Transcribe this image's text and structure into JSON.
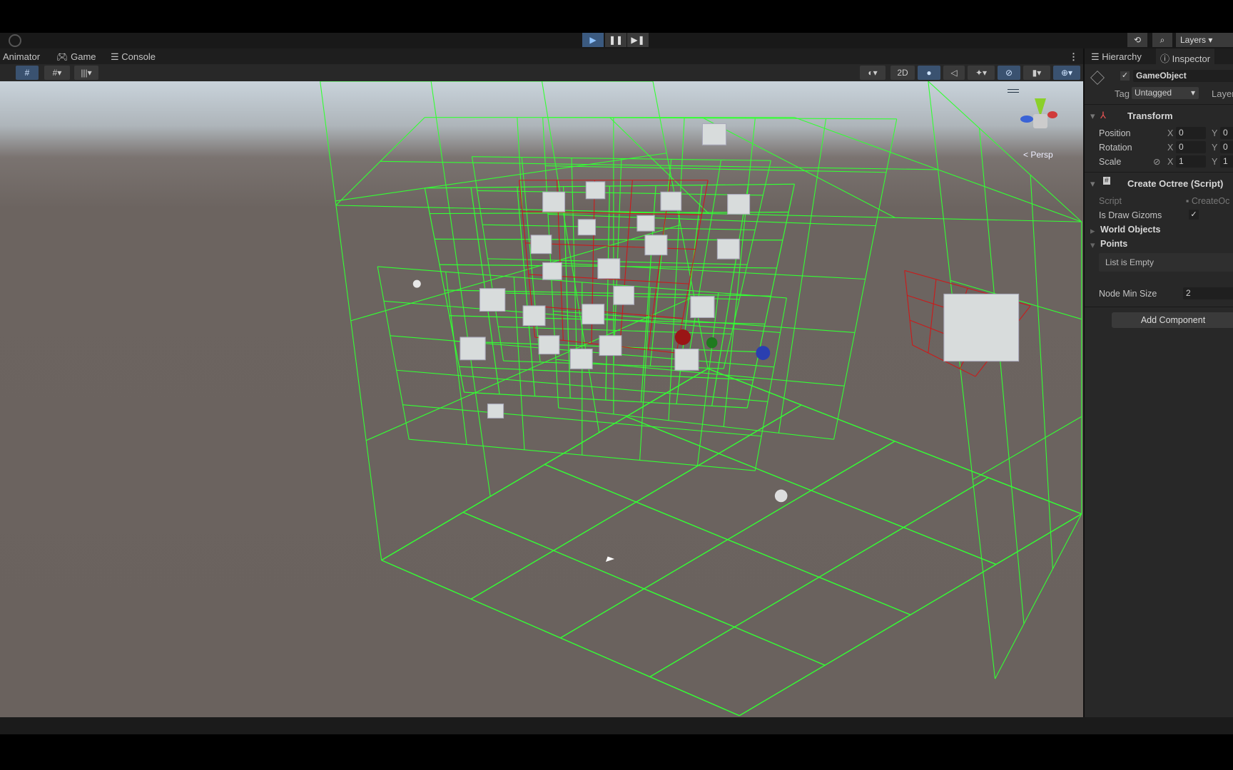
{
  "toolbar": {
    "play_icon": "play-icon",
    "pause_icon": "pause-icon",
    "step_icon": "step-icon",
    "play": "▶",
    "pause": "❚❚",
    "step": "▶❚",
    "history_icon": "history-icon",
    "search_icon": "search-icon",
    "layers": "Layers"
  },
  "tabs": {
    "animator": "Animator",
    "game": "Game",
    "console": "Console"
  },
  "scene_toolbar": {
    "mode_2d": "2D",
    "persp": "< Persp"
  },
  "inspector": {
    "tabs": {
      "hierarchy": "Hierarchy",
      "inspector": "Inspector"
    },
    "object_name": "GameObject",
    "active": true,
    "tag_label": "Tag",
    "tag_value": "Untagged",
    "layer_label": "Layer",
    "transform": {
      "title": "Transform",
      "position": {
        "label": "Position",
        "x": "0",
        "y": "0"
      },
      "rotation": {
        "label": "Rotation",
        "x": "0",
        "y": "0"
      },
      "scale": {
        "label": "Scale",
        "x": "1",
        "y": "1"
      },
      "x_label": "X",
      "y_label": "Y"
    },
    "script_component": {
      "title": "Create Octree (Script)",
      "script_label": "Script",
      "script_value": "CreateOc",
      "draw_gizmos_label": "Is Draw Gizoms",
      "draw_gizmos": true,
      "world_objects": "World Objects",
      "points": "Points",
      "points_empty": "List is Empty",
      "node_min_size_label": "Node Min Size",
      "node_min_size": "2"
    },
    "add_component": "Add Component"
  },
  "colors": {
    "octree_green": "#33ff33",
    "octree_red": "#cc1a1a",
    "play_active": "#3b5a80"
  }
}
